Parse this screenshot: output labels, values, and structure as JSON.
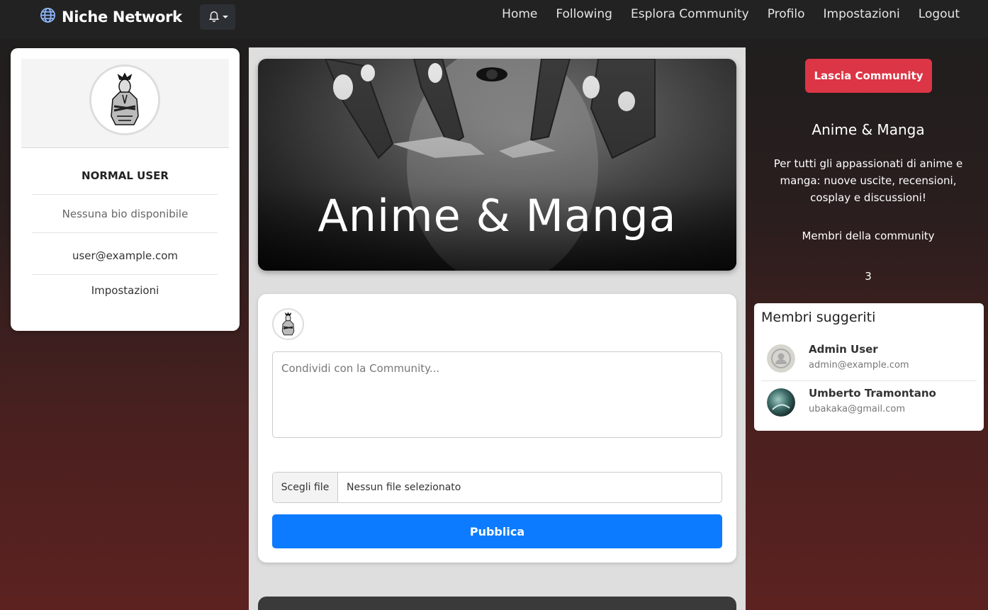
{
  "navbar": {
    "brand": "Niche Network",
    "links": [
      "Home",
      "Following",
      "Esplora Community",
      "Profilo",
      "Impostazioni",
      "Logout"
    ]
  },
  "profile": {
    "name": "NORMAL USER",
    "bio": "Nessuna bio disponibile",
    "email": "user@example.com",
    "settings_link": "Impostazioni"
  },
  "banner": {
    "title": "Anime & Manga"
  },
  "post_form": {
    "placeholder": "Condividi con la Community...",
    "file_button": "Scegli file",
    "file_status": "Nessun file selezionato",
    "submit_label": "Pubblica"
  },
  "community": {
    "leave_label": "Lascia Community",
    "name": "Anime & Manga",
    "description": "Per tutti gli appassionati di anime e manga: nuove uscite, recensioni, cosplay e discussioni!",
    "members_label": "Membri della community",
    "members_count": "3"
  },
  "suggested": {
    "title": "Membri suggeriti",
    "members": [
      {
        "name": "Admin User",
        "email": "admin@example.com"
      },
      {
        "name": "Umberto Tramontano",
        "email": "ubakaka@gmail.com"
      }
    ]
  },
  "colors": {
    "navbar": "#222222",
    "primary": "#0d7bff",
    "danger": "#dc3545"
  },
  "icons": [
    "globe-icon",
    "bell-icon",
    "chevron-down-icon"
  ]
}
